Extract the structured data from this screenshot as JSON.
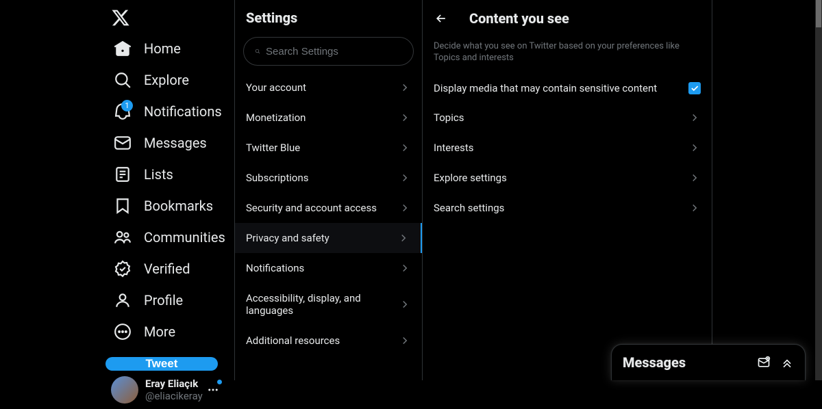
{
  "sidebar": {
    "items": [
      {
        "label": "Home",
        "icon": "home-icon"
      },
      {
        "label": "Explore",
        "icon": "search-icon"
      },
      {
        "label": "Notifications",
        "icon": "bell-icon",
        "badge": "1"
      },
      {
        "label": "Messages",
        "icon": "mail-icon"
      },
      {
        "label": "Lists",
        "icon": "list-icon"
      },
      {
        "label": "Bookmarks",
        "icon": "bookmark-icon"
      },
      {
        "label": "Communities",
        "icon": "people-icon"
      },
      {
        "label": "Verified",
        "icon": "verified-icon"
      },
      {
        "label": "Profile",
        "icon": "person-icon"
      },
      {
        "label": "More",
        "icon": "more-circle-icon"
      }
    ],
    "tweet_label": "Tweet",
    "user": {
      "name": "Eray Eliaçık",
      "handle": "@eliacikeray"
    }
  },
  "settings_col": {
    "title": "Settings",
    "search_placeholder": "Search Settings",
    "items": [
      "Your account",
      "Monetization",
      "Twitter Blue",
      "Subscriptions",
      "Security and account access",
      "Privacy and safety",
      "Notifications",
      "Accessibility, display, and languages",
      "Additional resources"
    ]
  },
  "detail_col": {
    "title": "Content you see",
    "description": "Decide what you see on Twitter based on your preferences like Topics and interests",
    "toggle_label": "Display media that may contain sensitive content",
    "toggle_checked": true,
    "links": [
      "Topics",
      "Interests",
      "Explore settings",
      "Search settings"
    ]
  },
  "messages_dock": {
    "title": "Messages"
  }
}
